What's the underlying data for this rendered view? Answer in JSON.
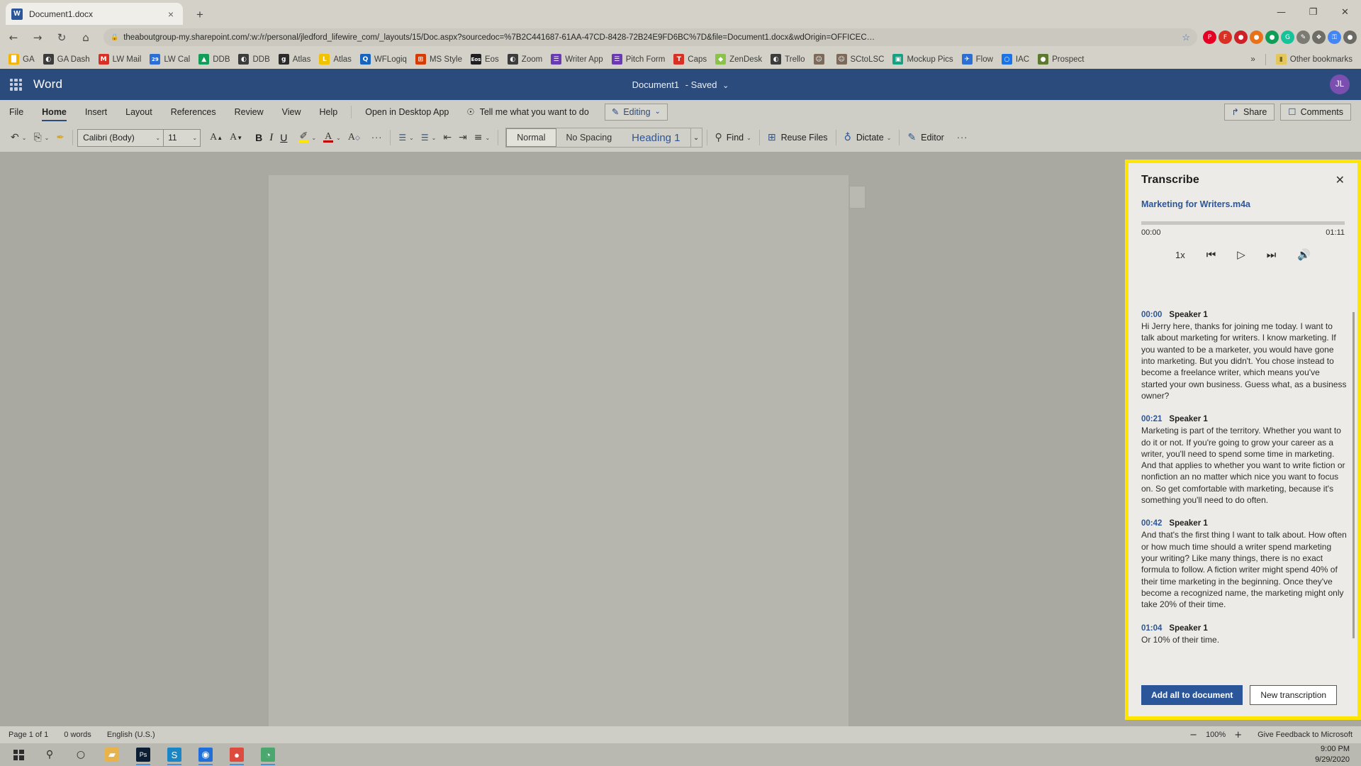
{
  "browser": {
    "tab": {
      "title": "Document1.docx",
      "favicon_letter": "W",
      "favicon_name": "word-favicon",
      "close_label": "×"
    },
    "new_tab_label": "+",
    "nav": {
      "back": "←",
      "forward": "→",
      "reload": "↻",
      "home": "⌂"
    },
    "omnibox": {
      "lock": "🔒",
      "url": "theaboutgroup-my.sharepoint.com/:w:/r/personal/jledford_lifewire_com/_layouts/15/Doc.aspx?sourcedoc=%7B2C441687-61AA-47CD-8428-72B24E9FD6BC%7D&file=Document1.docx&wdOrigin=OFFICEC…",
      "star": "☆"
    },
    "window_controls": {
      "minimize": "—",
      "maximize": "❐",
      "close": "✕"
    },
    "extensions": [
      {
        "name": "pinterest-extension",
        "glyph": "P",
        "color": "#e60023"
      },
      {
        "name": "bookmark-extension",
        "glyph": "F",
        "color": "#d93025"
      },
      {
        "name": "red-extension",
        "glyph": "●",
        "color": "#cc2127"
      },
      {
        "name": "orange-extension",
        "glyph": "●",
        "color": "#e8711a"
      },
      {
        "name": "green-extension",
        "glyph": "●",
        "color": "#0f9d58"
      },
      {
        "name": "grammarly-extension",
        "glyph": "G",
        "color": "#15c39a"
      },
      {
        "name": "pen-extension",
        "glyph": "✎",
        "color": "#7b7b74"
      },
      {
        "name": "puzzle-extension",
        "glyph": "❖",
        "color": "#6e6e67"
      },
      {
        "name": "key-extension",
        "glyph": "⚿",
        "color": "#4285f4"
      },
      {
        "name": "chrome-profile-avatar",
        "glyph": "●",
        "color": "#6b6b66"
      }
    ],
    "bookmarks": [
      {
        "label": "GA",
        "icon": "bar-chart-icon",
        "glyph": "█",
        "color": "#f4b400"
      },
      {
        "label": "GA Dash",
        "icon": "globe-icon",
        "glyph": "◐",
        "color": "#3c3c3c"
      },
      {
        "label": "LW Mail",
        "icon": "gmail-icon",
        "glyph": "M",
        "color": "#d93025"
      },
      {
        "label": "LW Cal",
        "icon": "calendar-icon",
        "glyph": "29",
        "color": "#2a6ed6"
      },
      {
        "label": "DDB",
        "icon": "drive-icon",
        "glyph": "▲",
        "color": "#0f9d58"
      },
      {
        "label": "DDB",
        "icon": "globe-icon",
        "glyph": "◐",
        "color": "#3c3c3c"
      },
      {
        "label": "Atlas",
        "icon": "g-icon",
        "glyph": "g",
        "color": "#2b2b2b"
      },
      {
        "label": "Atlas",
        "icon": "l-icon",
        "glyph": "L",
        "color": "#f2c200"
      },
      {
        "label": "WFLogiq",
        "icon": "circle-q-icon",
        "glyph": "Q",
        "color": "#1565c0"
      },
      {
        "label": "MS Style",
        "icon": "microsoft-icon",
        "glyph": "⊞",
        "color": "#d83b01"
      },
      {
        "label": "Eos",
        "icon": "eos-icon",
        "glyph": "Eos",
        "color": "#1f1f1f"
      },
      {
        "label": "Zoom",
        "icon": "globe-icon",
        "glyph": "◐",
        "color": "#3c3c3c"
      },
      {
        "label": "Writer App",
        "icon": "list-icon",
        "glyph": "☰",
        "color": "#6a3ab2"
      },
      {
        "label": "Pitch Form",
        "icon": "list-icon",
        "glyph": "☰",
        "color": "#6a3ab2"
      },
      {
        "label": "Caps",
        "icon": "t-icon",
        "glyph": "T",
        "color": "#d93025"
      },
      {
        "label": "ZenDesk",
        "icon": "leaf-icon",
        "glyph": "◆",
        "color": "#8bc34a"
      },
      {
        "label": "Trello",
        "icon": "globe-icon",
        "glyph": "◐",
        "color": "#3c3c3c"
      },
      {
        "label": "",
        "icon": "avatar-icon",
        "glyph": "☺",
        "color": "#7b6a5a"
      },
      {
        "label": "SCtoLSC",
        "icon": "avatar-icon",
        "glyph": "☺",
        "color": "#7b6a5a"
      },
      {
        "label": "Mockup Pics",
        "icon": "mockup-icon",
        "glyph": "▣",
        "color": "#13a383"
      },
      {
        "label": "Flow",
        "icon": "flow-icon",
        "glyph": "✈",
        "color": "#2b6fd4"
      },
      {
        "label": "IAC",
        "icon": "circle-icon",
        "glyph": "○",
        "color": "#1a73e8"
      },
      {
        "label": "Prospect",
        "icon": "cup-icon",
        "glyph": "●",
        "color": "#5c7a2e"
      }
    ],
    "overflow_label": "»",
    "other_bookmarks": {
      "label": "Other bookmarks",
      "icon": "folder-icon",
      "glyph": "▮"
    }
  },
  "word": {
    "brand": "Word",
    "doc_title": "Document1",
    "save_state": "- Saved",
    "save_caret": "⌄",
    "avatar_initials": "JL",
    "ribbon_tabs": [
      {
        "label": "File",
        "active": false
      },
      {
        "label": "Home",
        "active": true
      },
      {
        "label": "Insert",
        "active": false
      },
      {
        "label": "Layout",
        "active": false
      },
      {
        "label": "References",
        "active": false
      },
      {
        "label": "Review",
        "active": false
      },
      {
        "label": "View",
        "active": false
      },
      {
        "label": "Help",
        "active": false
      }
    ],
    "open_desktop": "Open in Desktop App",
    "tell_me": {
      "icon": "lightbulb-icon",
      "glyph": "☉",
      "label": "Tell me what you want to do"
    },
    "editing_btn": {
      "icon": "pencil-icon",
      "glyph": "✎",
      "label": "Editing",
      "caret": "⌄"
    },
    "share_btn": {
      "icon": "share-icon",
      "glyph": "↱",
      "label": "Share"
    },
    "comments_btn": {
      "icon": "comment-icon",
      "glyph": "☐",
      "label": "Comments"
    },
    "toolbar": {
      "undo": {
        "name": "undo-icon",
        "glyph": "↶",
        "caret": "⌄"
      },
      "paste": {
        "name": "paste-icon",
        "glyph": "⎘",
        "caret": "⌄"
      },
      "format_painter": {
        "name": "format-painter-icon",
        "glyph": "✒"
      },
      "font_name": "Calibri (Body)",
      "font_size": "11",
      "grow_font": {
        "name": "grow-font-icon",
        "glyph": "A"
      },
      "shrink_font": {
        "name": "shrink-font-icon",
        "glyph": "A"
      },
      "bold": "B",
      "italic": "I",
      "underline": "U",
      "highlight": {
        "name": "highlight-icon",
        "glyph": "✐",
        "caret": "⌄"
      },
      "font_color": {
        "name": "font-color-icon",
        "glyph": "A",
        "caret": "⌄"
      },
      "clear_format": {
        "name": "clear-formatting-icon",
        "glyph": "A"
      },
      "more": "···",
      "bullets": {
        "name": "bullets-icon",
        "glyph": "☰",
        "caret": "⌄"
      },
      "numbering": {
        "name": "numbering-icon",
        "glyph": "☰",
        "caret": "⌄"
      },
      "decrease_indent": {
        "name": "decrease-indent-icon",
        "glyph": "⇤"
      },
      "increase_indent": {
        "name": "increase-indent-icon",
        "glyph": "⇥"
      },
      "align": {
        "name": "align-icon",
        "glyph": "≡",
        "caret": "⌄"
      },
      "styles": [
        "Normal",
        "No Spacing",
        "Heading 1"
      ],
      "styles_more": "⌄",
      "find": {
        "name": "find-icon",
        "glyph": "⚲",
        "label": "Find",
        "caret": "⌄"
      },
      "reuse_files": {
        "name": "reuse-files-icon",
        "glyph": "⊞",
        "label": "Reuse Files"
      },
      "dictate": {
        "name": "microphone-icon",
        "glyph": "♁",
        "label": "Dictate",
        "caret": "⌄"
      },
      "editor": {
        "name": "editor-icon",
        "glyph": "✎",
        "label": "Editor"
      },
      "overflow": "···"
    },
    "status_bar": {
      "page": "Page 1 of 1",
      "words": "0 words",
      "language": "English (U.S.)",
      "zoom_out": "−",
      "zoom_level": "100%",
      "zoom_in": "+",
      "feedback": "Give Feedback to Microsoft"
    }
  },
  "transcribe": {
    "title": "Transcribe",
    "close": "✕",
    "file_name": "Marketing for Writers.m4a",
    "time_start": "00:00",
    "time_end": "01:11",
    "controls": {
      "speed": "1x",
      "rewind": {
        "name": "rewind-icon",
        "glyph": "⏮"
      },
      "play": {
        "name": "play-icon",
        "glyph": "▷"
      },
      "forward": {
        "name": "fast-forward-icon",
        "glyph": "⏭"
      },
      "volume": {
        "name": "volume-icon",
        "glyph": "🔊"
      }
    },
    "segments": [
      {
        "time": "00:00",
        "speaker": "Speaker 1",
        "text": "Hi Jerry here, thanks for joining me today. I want to talk about marketing for writers. I know marketing. If you wanted to be a marketer, you would have gone into marketing. But you didn't. You chose instead to become a freelance writer, which means you've started your own business. Guess what, as a business owner?"
      },
      {
        "time": "00:21",
        "speaker": "Speaker 1",
        "text": "Marketing is part of the territory. Whether you want to do it or not. If you're going to grow your career as a writer, you'll need to spend some time in marketing. And that applies to whether you want to write fiction or nonfiction an no matter which nice you want to focus on. So get comfortable with marketing, because it's something you'll need to do often."
      },
      {
        "time": "00:42",
        "speaker": "Speaker 1",
        "text": "And that's the first thing I want to talk about. How often or how much time should a writer spend marketing your writing? Like many things, there is no exact formula to follow. A fiction writer might spend 40% of their time marketing in the beginning. Once they've become a recognized name, the marketing might only take 20% of their time."
      },
      {
        "time": "01:04",
        "speaker": "Speaker 1",
        "text": "Or 10% of their time."
      }
    ],
    "add_all_button": "Add all to document",
    "new_transcription_button": "New transcription",
    "highlight_color": "#ffe600",
    "accent_color": "#2b579a"
  },
  "taskbar": {
    "start": {
      "name": "start-icon"
    },
    "search": {
      "name": "search-icon",
      "glyph": "⚲"
    },
    "cortana": {
      "name": "cortana-icon",
      "glyph": "○"
    },
    "items": [
      {
        "name": "file-explorer-icon",
        "glyph": "▰",
        "color": "#e8b34a",
        "running": false
      },
      {
        "name": "photoshop-icon",
        "glyph": "Ps",
        "color": "#0b1e33",
        "running": true
      },
      {
        "name": "skype-icon",
        "glyph": "S",
        "color": "#1b86c6",
        "running": true
      },
      {
        "name": "app-icon",
        "glyph": "◉",
        "color": "#1e6fd9",
        "running": true
      },
      {
        "name": "chrome-icon",
        "glyph": "●",
        "color": "#dd4b3e",
        "running": true
      },
      {
        "name": "edge-icon",
        "glyph": "◔",
        "color": "#4aa86f",
        "running": true
      }
    ],
    "clock_time": "9:00 PM",
    "clock_date": "9/29/2020"
  }
}
